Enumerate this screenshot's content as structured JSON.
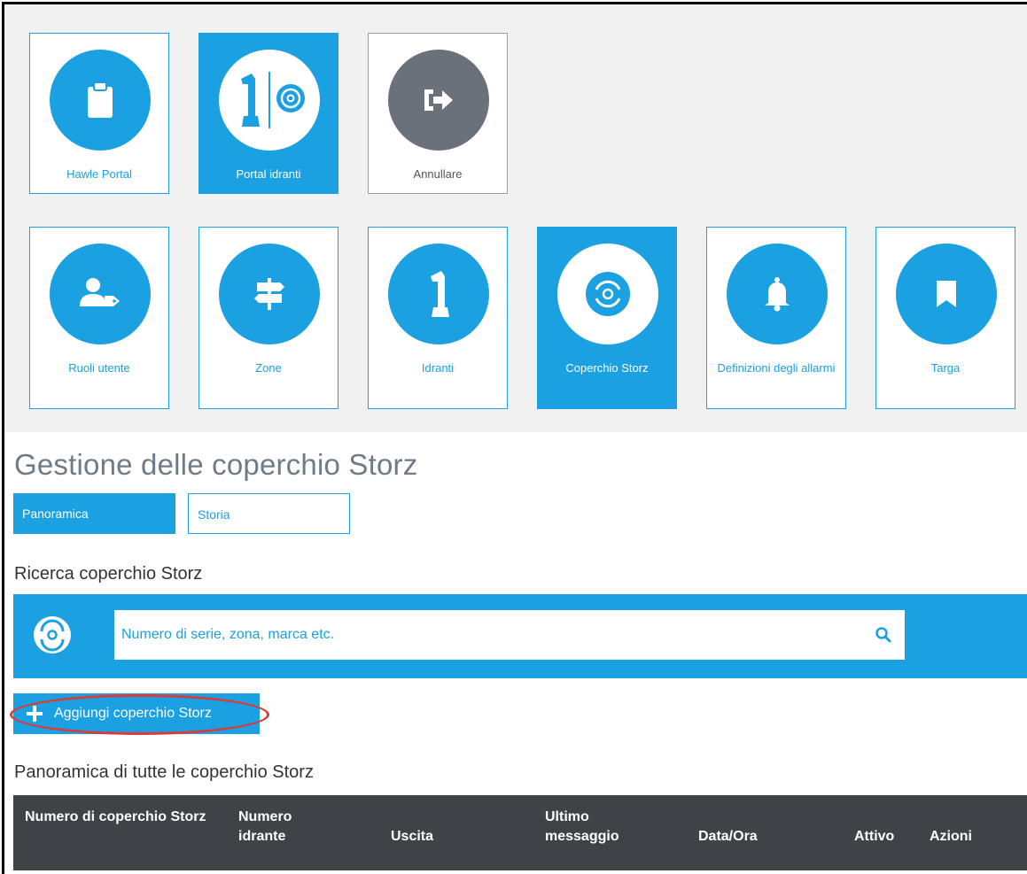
{
  "apps": [
    {
      "label": "Hawle Portal",
      "icon": "clipboard-icon",
      "active": false
    },
    {
      "label": "Portal idranti",
      "icon": "hydrant-storz-icon",
      "active": true
    },
    {
      "label": "Annullare",
      "icon": "sign-out-icon",
      "active": false
    }
  ],
  "modules": [
    {
      "label": "Ruoli utente",
      "icon": "user-tag-icon"
    },
    {
      "label": "Zone",
      "icon": "signpost-icon"
    },
    {
      "label": "Idranti",
      "icon": "hydrant-icon"
    },
    {
      "label": "Coperchio Storz",
      "icon": "storz-cap-icon",
      "active": true
    },
    {
      "label": "Definizioni degli allarmi",
      "icon": "bell-icon"
    },
    {
      "label": "Targa",
      "icon": "bookmark-icon"
    }
  ],
  "page": {
    "title": "Gestione delle coperchio Storz",
    "tabs": [
      "Panoramica",
      "Storia"
    ],
    "search_title": "Ricerca coperchio Storz",
    "search_placeholder": "Numero di serie, zona, marca etc.",
    "add_label": "Aggiungi coperchio Storz",
    "overview_title": "Panoramica di tutte le coperchio Storz"
  },
  "table": {
    "headers": [
      "Numero di coperchio Storz",
      "Numero idrante",
      "Uscita",
      "Ultimo messaggio",
      "Data/Ora",
      "Attivo",
      "Azioni"
    ]
  },
  "colors": {
    "accent": "#1ba0e2",
    "dark": "#3f4347",
    "highlight": "#d63d3d",
    "muted": "#6b717a"
  }
}
